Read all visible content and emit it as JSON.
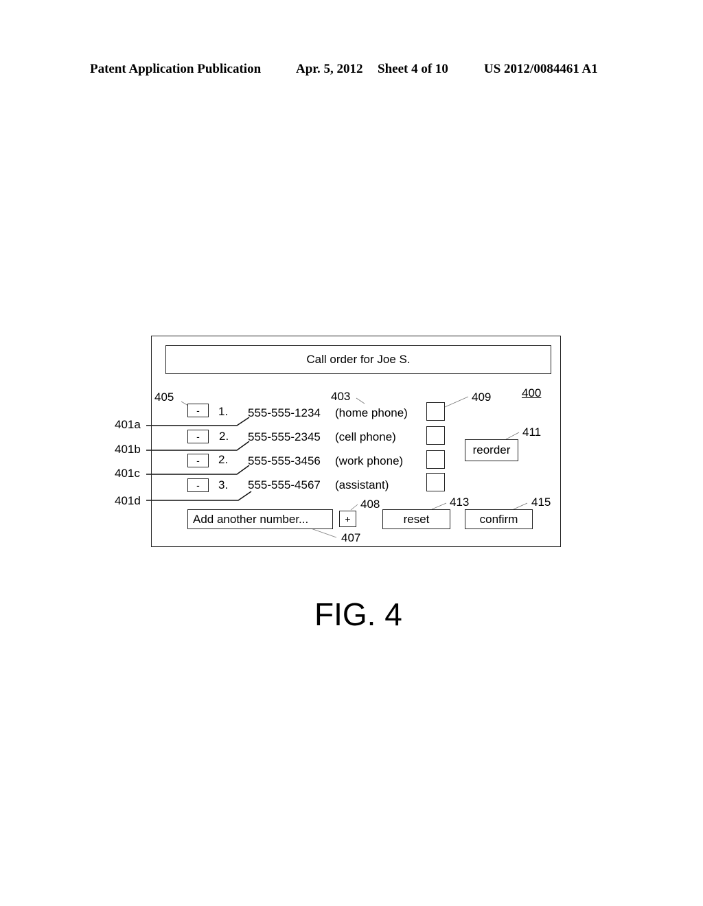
{
  "header": {
    "left": "Patent Application Publication",
    "date": "Apr. 5, 2012",
    "sheet": "Sheet 4 of 10",
    "pub_number": "US 2012/0084461 A1"
  },
  "figure_label": "FIG. 4",
  "ui": {
    "title": "Call order for Joe S.",
    "rows": [
      {
        "remove_label": "-",
        "order": "1.",
        "number": "555-555-1234",
        "type": "(home phone)",
        "checked": false
      },
      {
        "remove_label": "-",
        "order": "2.",
        "number": "555-555-2345",
        "type": "(cell phone)",
        "checked": false
      },
      {
        "remove_label": "-",
        "order": "2.",
        "number": "555-555-3456",
        "type": "(work phone)",
        "checked": false
      },
      {
        "remove_label": "-",
        "order": "3.",
        "number": "555-555-4567",
        "type": "(assistant)",
        "checked": false
      }
    ],
    "add_input_placeholder": "Add another number...",
    "add_button": "+",
    "reorder_button": "reorder",
    "reset_button": "reset",
    "confirm_button": "confirm"
  },
  "reference_numerals": {
    "r400": "400",
    "r401a": "401a",
    "r401b": "401b",
    "r401c": "401c",
    "r401d": "401d",
    "r403": "403",
    "r405": "405",
    "r407": "407",
    "r408": "408",
    "r409": "409",
    "r411": "411",
    "r413": "413",
    "r415": "415"
  }
}
